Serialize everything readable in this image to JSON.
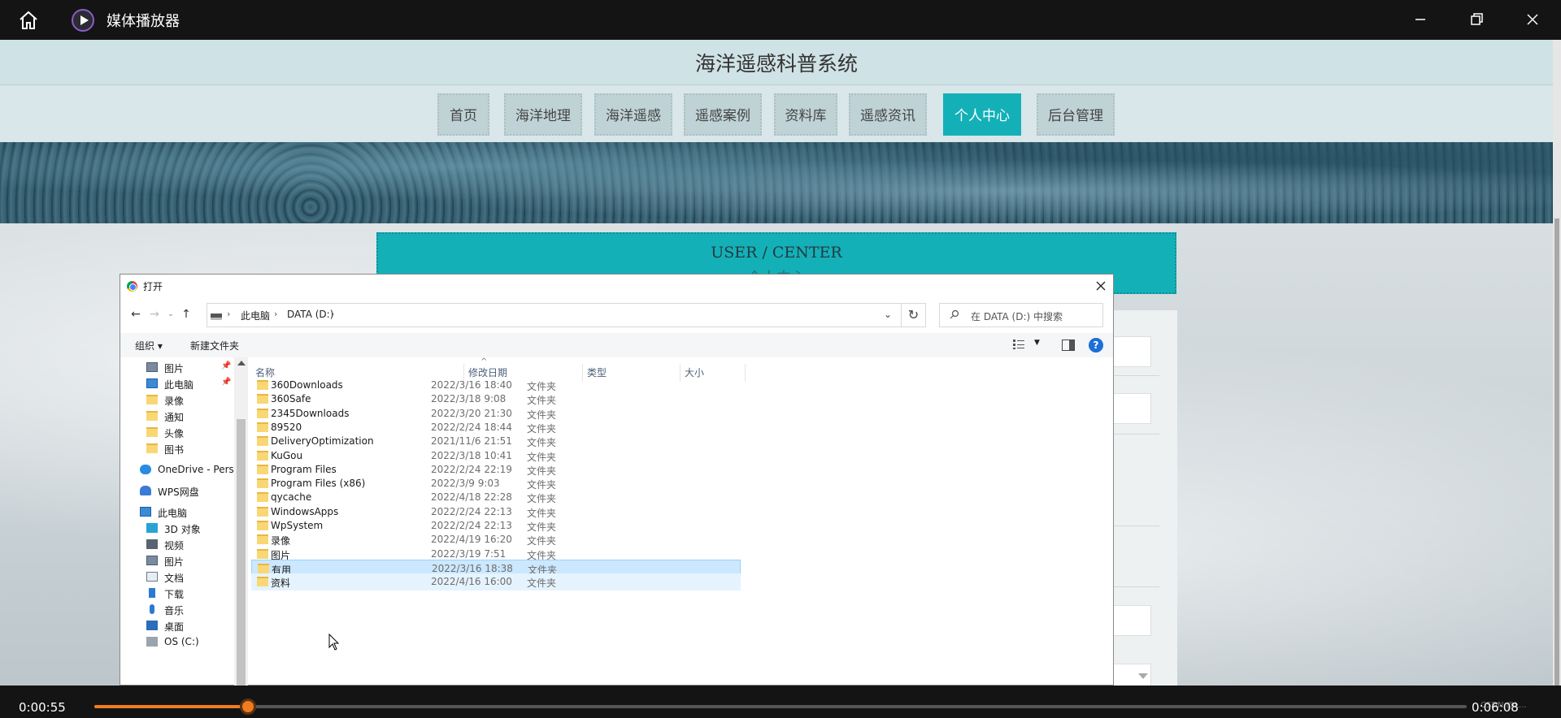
{
  "player": {
    "title": "媒体播放器",
    "time_current": "0:00:55",
    "time_total": "0:06:08",
    "progress_fraction": 0.112,
    "watermark": "CSDN @L..."
  },
  "site": {
    "title": "海洋遥感科普系统",
    "nav": [
      "首页",
      "海洋地理",
      "海洋遥感",
      "遥感案例",
      "资料库",
      "遥感资讯",
      "个人中心",
      "后台管理"
    ],
    "active_nav": "个人中心",
    "user_center_title": "USER / CENTER",
    "user_center_subtitle": "个人中心"
  },
  "dialog": {
    "title": "打开",
    "address": {
      "crumbs": [
        "此电脑",
        "DATA (D:)"
      ]
    },
    "search_placeholder": "在 DATA (D:) 中搜索",
    "toolbar": {
      "organize": "组织 ▾",
      "new_folder": "新建文件夹"
    },
    "nav_pane": [
      {
        "label": "图片",
        "icon": "pictures-icon",
        "pinned": true
      },
      {
        "label": "此电脑",
        "icon": "computer-icon",
        "pinned": true
      },
      {
        "label": "录像",
        "icon": "folder-icon"
      },
      {
        "label": "通知",
        "icon": "folder-icon"
      },
      {
        "label": "头像",
        "icon": "folder-icon"
      },
      {
        "label": "图书",
        "icon": "folder-icon"
      },
      {
        "label": "OneDrive - Perso",
        "icon": "cloud-icon"
      },
      {
        "label": "WPS网盘",
        "icon": "wps-cloud-icon"
      },
      {
        "label": "此电脑",
        "icon": "computer-icon"
      },
      {
        "label": "3D 对象",
        "icon": "cube-icon"
      },
      {
        "label": "视频",
        "icon": "video-icon"
      },
      {
        "label": "图片",
        "icon": "pictures-icon"
      },
      {
        "label": "文档",
        "icon": "document-icon"
      },
      {
        "label": "下载",
        "icon": "download-icon"
      },
      {
        "label": "音乐",
        "icon": "music-icon"
      },
      {
        "label": "桌面",
        "icon": "desktop-icon"
      },
      {
        "label": "OS (C:)",
        "icon": "drive-icon"
      }
    ],
    "columns": [
      "名称",
      "修改日期",
      "类型",
      "大小"
    ],
    "files": [
      {
        "name": "360Downloads",
        "date": "2022/3/16 18:40",
        "type": "文件夹"
      },
      {
        "name": "360Safe",
        "date": "2022/3/18 9:08",
        "type": "文件夹"
      },
      {
        "name": "2345Downloads",
        "date": "2022/3/20 21:30",
        "type": "文件夹"
      },
      {
        "name": "89520",
        "date": "2022/2/24 18:44",
        "type": "文件夹"
      },
      {
        "name": "DeliveryOptimization",
        "date": "2021/11/6 21:51",
        "type": "文件夹"
      },
      {
        "name": "KuGou",
        "date": "2022/3/18 10:41",
        "type": "文件夹"
      },
      {
        "name": "Program Files",
        "date": "2022/2/24 22:19",
        "type": "文件夹"
      },
      {
        "name": "Program Files (x86)",
        "date": "2022/3/9 9:03",
        "type": "文件夹"
      },
      {
        "name": "qycache",
        "date": "2022/4/18 22:28",
        "type": "文件夹"
      },
      {
        "name": "WindowsApps",
        "date": "2022/2/24 22:13",
        "type": "文件夹"
      },
      {
        "name": "WpSystem",
        "date": "2022/2/24 22:13",
        "type": "文件夹"
      },
      {
        "name": "录像",
        "date": "2022/4/19 16:20",
        "type": "文件夹"
      },
      {
        "name": "图片",
        "date": "2022/3/19 7:51",
        "type": "文件夹"
      },
      {
        "name": "有用",
        "date": "2022/3/16 18:38",
        "type": "文件夹",
        "state": "selected"
      },
      {
        "name": "资料",
        "date": "2022/4/16 16:00",
        "type": "文件夹",
        "state": "hover"
      }
    ]
  },
  "colors": {
    "accent": "#14b0b8",
    "progress": "#f07c1f",
    "selection": "#cce8ff"
  }
}
